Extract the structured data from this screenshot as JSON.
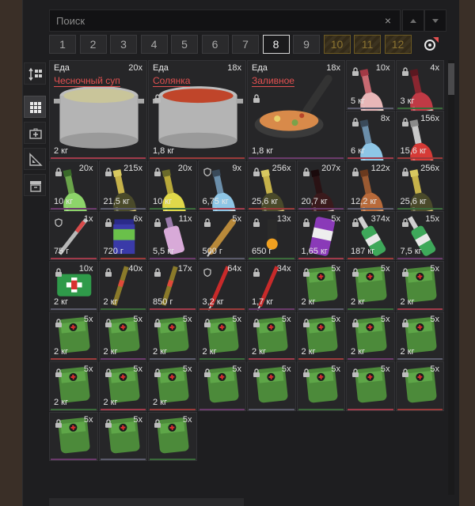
{
  "search": {
    "placeholder": "Поиск",
    "clear_icon": "×"
  },
  "tabs": [
    "1",
    "2",
    "3",
    "4",
    "5",
    "6",
    "7",
    "8",
    "9",
    "10",
    "11",
    "12"
  ],
  "active_tab": "8",
  "locked_tabs": [
    "10",
    "11",
    "12"
  ],
  "toolbar": [
    "sort-icon",
    "grid-view-icon",
    "medkit-category-icon",
    "tools-category-icon",
    "storage-box-icon"
  ],
  "colors": {
    "panel": "#1e1e20",
    "name_red": "#e25050",
    "tab_locked": "#8b7330",
    "med_green": "#4c8a3a"
  },
  "items": [
    {
      "cat": "Еда",
      "name": "Чесночный суп",
      "qty": "20x",
      "weight": "2 кг",
      "icon": "soup-pot-icon"
    },
    {
      "cat": "Еда",
      "name": "Солянка",
      "qty": "18x",
      "weight": "1,8 кг",
      "icon": "soup-pot-red-icon"
    },
    {
      "cat": "Еда",
      "name": "Заливное",
      "qty": "18x",
      "weight": "1,8 кг",
      "icon": "frying-pan-icon"
    },
    {
      "qty": "10x",
      "weight": "5 кг",
      "icon": "wine-bottle-pink-icon"
    },
    {
      "qty": "4x",
      "weight": "3 кг",
      "icon": "wine-bottle-red-icon"
    },
    {
      "qty": "8x",
      "weight": "6 кг",
      "icon": "bottle-blue-icon"
    },
    {
      "qty": "156x",
      "weight": "15,6 кг",
      "icon": "vodka-bottle-red-icon"
    },
    {
      "qty": "20x",
      "weight": "10 кг",
      "icon": "bottle-green-icon"
    },
    {
      "qty": "215x",
      "weight": "21,5 кг",
      "icon": "champagne-bottle-icon"
    },
    {
      "qty": "20x",
      "weight": "10 кг",
      "icon": "bottle-yellow-icon"
    },
    {
      "qty": "9x",
      "weight": "6,75 кг",
      "icon": "bottle-blue-icon"
    },
    {
      "qty": "256x",
      "weight": "25,6 кг",
      "icon": "champagne-bottle-icon"
    },
    {
      "qty": "207x",
      "weight": "20,7 кг",
      "icon": "wine-bottle-dark-icon"
    },
    {
      "qty": "122x",
      "weight": "12,2 кг",
      "icon": "clay-bottle-icon"
    },
    {
      "qty": "256x",
      "weight": "25,6 кг",
      "icon": "champagne-bottle-icon"
    },
    {
      "qty": "1x",
      "weight": "75 г",
      "icon": "syringe-icon"
    },
    {
      "qty": "6x",
      "weight": "720 г",
      "icon": "pill-jar-icon"
    },
    {
      "qty": "11x",
      "weight": "5,5 кг",
      "icon": "small-bottle-pink-icon"
    },
    {
      "qty": "5x",
      "weight": "500 г",
      "icon": "injector-icon"
    },
    {
      "qty": "13x",
      "weight": "650 г",
      "icon": "stimulator-icon"
    },
    {
      "qty": "5x",
      "weight": "1,65 кг",
      "icon": "purple-can-icon"
    },
    {
      "qty": "374x",
      "weight": "187 кг",
      "icon": "green-bottle-icon"
    },
    {
      "qty": "15x",
      "weight": "7,5 кг",
      "icon": "green-bottle-icon"
    },
    {
      "qty": "10x",
      "weight": "2 кг",
      "icon": "first-aid-kit-icon"
    },
    {
      "qty": "40x",
      "weight": "2 кг",
      "icon": "tube-injector-icon"
    },
    {
      "qty": "17x",
      "weight": "850 г",
      "icon": "tube-injector-icon"
    },
    {
      "qty": "64x",
      "weight": "3,2 кг",
      "icon": "red-injector-icon"
    },
    {
      "qty": "34x",
      "weight": "1,7 кг",
      "icon": "red-injector-icon"
    },
    {
      "qty": "5x",
      "weight": "2 кг",
      "icon": "medkit-bag-icon"
    },
    {
      "qty": "5x",
      "weight": "2 кг",
      "icon": "medkit-bag-icon"
    },
    {
      "qty": "5x",
      "weight": "2 кг",
      "icon": "medkit-bag-icon"
    },
    {
      "qty": "5x",
      "weight": "2 кг",
      "icon": "medkit-bag-icon"
    },
    {
      "qty": "5x",
      "weight": "2 кг",
      "icon": "medkit-bag-icon"
    },
    {
      "qty": "5x",
      "weight": "2 кг",
      "icon": "medkit-bag-icon"
    },
    {
      "qty": "5x",
      "weight": "2 кг",
      "icon": "medkit-bag-icon"
    },
    {
      "qty": "5x",
      "weight": "2 кг",
      "icon": "medkit-bag-icon"
    },
    {
      "qty": "5x",
      "weight": "2 кг",
      "icon": "medkit-bag-icon"
    },
    {
      "qty": "5x",
      "weight": "2 кг",
      "icon": "medkit-bag-icon"
    },
    {
      "qty": "5x",
      "weight": "2 кг",
      "icon": "medkit-bag-icon"
    },
    {
      "qty": "5x",
      "weight": "2 кг",
      "icon": "medkit-bag-icon"
    },
    {
      "qty": "5x",
      "weight": "2 кг",
      "icon": "medkit-bag-icon"
    },
    {
      "qty": "5x",
      "weight": "2 кг",
      "icon": "medkit-bag-icon"
    },
    {
      "qty": "5x",
      "icon": "medkit-bag-icon"
    },
    {
      "qty": "5x",
      "icon": "medkit-bag-icon"
    },
    {
      "qty": "5x",
      "icon": "medkit-bag-icon"
    },
    {
      "qty": "5x",
      "icon": "medkit-bag-icon"
    },
    {
      "qty": "5x",
      "icon": "medkit-bag-icon"
    },
    {
      "qty": "5x",
      "icon": "medkit-bag-icon"
    },
    {
      "qty": "5x",
      "icon": "medkit-bag-icon"
    },
    {
      "qty": "5x",
      "icon": "medkit-bag-icon"
    }
  ]
}
